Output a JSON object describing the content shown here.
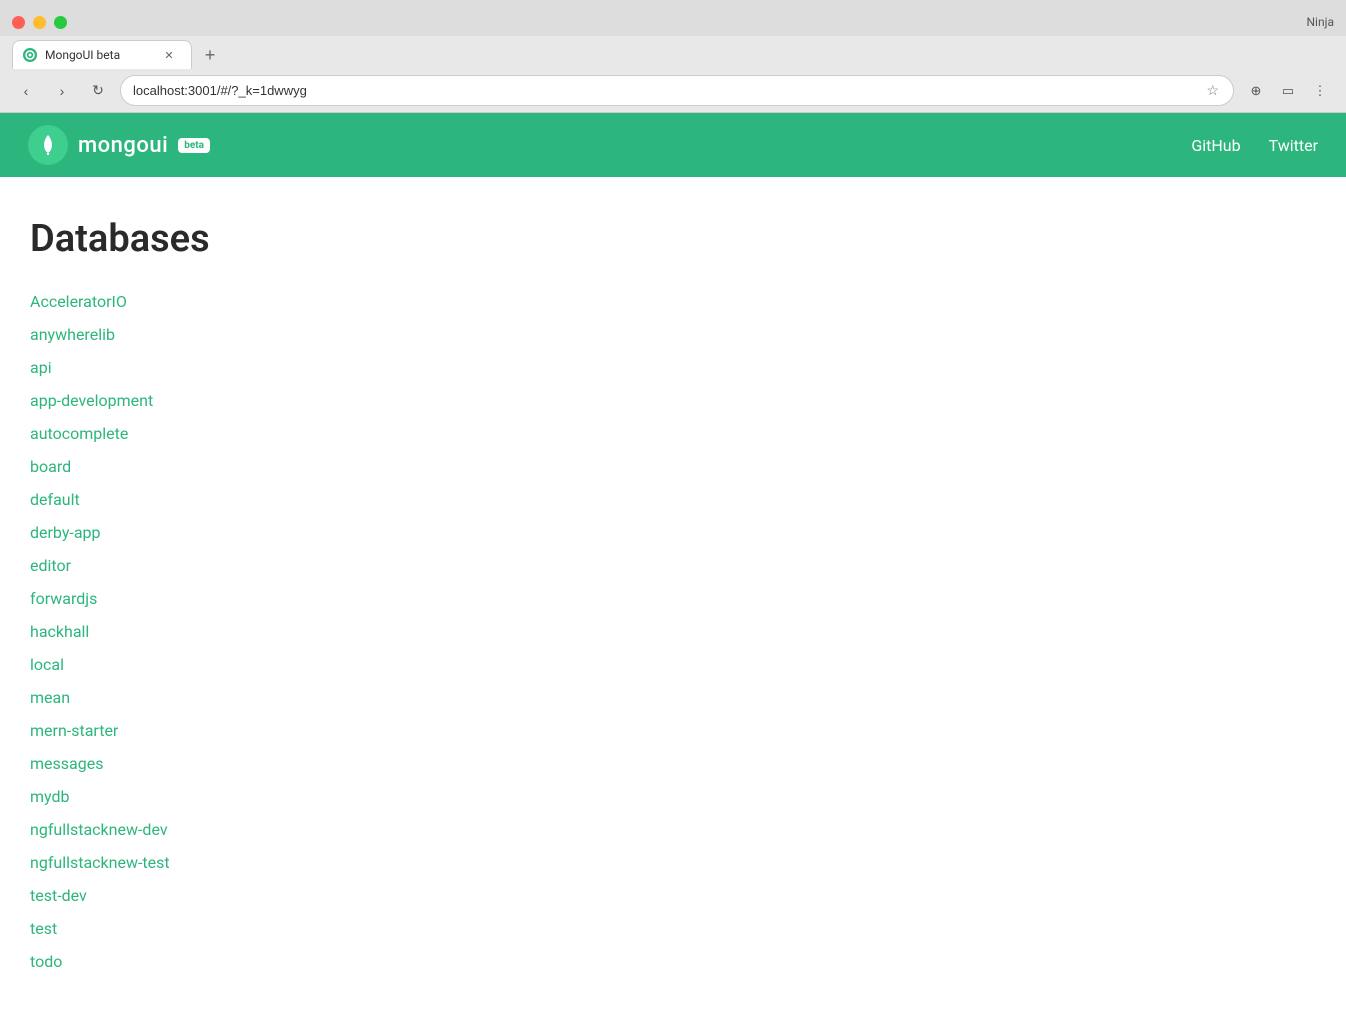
{
  "browser": {
    "tab_title": "MongoUI beta",
    "address": "localhost:3001/#/?_k=1dwwyg",
    "user": "Ninja",
    "new_tab_icon": "+"
  },
  "navbar": {
    "brand_name": "mongoui",
    "brand_badge": "beta",
    "github_label": "GitHub",
    "twitter_label": "Twitter"
  },
  "main": {
    "page_title": "Databases",
    "databases": [
      "AcceleratorIO",
      "anywherelib",
      "api",
      "app-development",
      "autocomplete",
      "board",
      "default",
      "derby-app",
      "editor",
      "forwardjs",
      "hackhall",
      "local",
      "mean",
      "mern-starter",
      "messages",
      "mydb",
      "ngfullstacknew-dev",
      "ngfullstacknew-test",
      "test-dev",
      "test",
      "todo"
    ]
  }
}
